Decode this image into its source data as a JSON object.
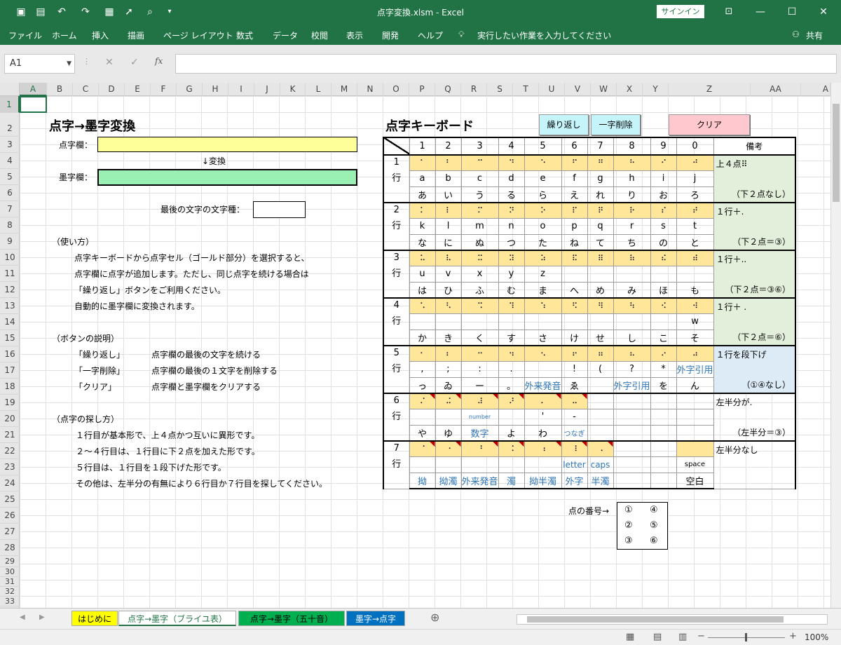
{
  "window": {
    "title": "点字変換.xlsm  -  Excel",
    "signin": "サインイン",
    "share": "共有"
  },
  "menu": {
    "items": [
      "ファイル",
      "ホーム",
      "挿入",
      "描画",
      "ページ レイアウト",
      "数式",
      "データ",
      "校閲",
      "表示",
      "開発",
      "ヘルプ"
    ],
    "tell_me": "実行したい作業を入力してください"
  },
  "formula_bar": {
    "name_box": "A1",
    "fx": "fx",
    "value": ""
  },
  "columns": [
    "A",
    "B",
    "C",
    "D",
    "E",
    "F",
    "G",
    "H",
    "I",
    "J",
    "K",
    "L",
    "M",
    "N",
    "O",
    "P",
    "Q",
    "R",
    "S",
    "T",
    "U",
    "V",
    "W",
    "X",
    "Y",
    "Z",
    "AA",
    "A"
  ],
  "rows": [
    "1",
    "2",
    "3",
    "4",
    "5",
    "6",
    "7",
    "8",
    "9",
    "10",
    "11",
    "12",
    "13",
    "14",
    "15",
    "16",
    "17",
    "18",
    "19",
    "20",
    "21",
    "22",
    "23",
    "24",
    "25",
    "26",
    "27",
    "28",
    "29",
    "30",
    "31",
    "32",
    "33"
  ],
  "left": {
    "title": "点字→墨字変換",
    "braille_label": "点字欄：",
    "convert_label": "↓変換",
    "text_label": "墨字欄：",
    "last_type_label": "最後の文字の文字種：",
    "usage_head": "（使い方）",
    "usage": [
      "点字キーボードから点字セル（ゴールド部分）を選択すると、",
      "点字欄に点字が追加します。ただし、同じ点字を続ける場合は",
      "「繰り返し」ボタンをご利用ください。",
      "自動的に墨字欄に変換されます。"
    ],
    "buttons_head": "（ボタンの説明）",
    "buttons": [
      [
        "「繰り返し」",
        "点字欄の最後の文字を続ける"
      ],
      [
        "「一字削除」",
        "点字欄の最後の１文字を削除する"
      ],
      [
        "「クリア」",
        "点字欄と墨字欄をクリアする"
      ]
    ],
    "search_head": "（点字の探し方）",
    "search": [
      "１行目が基本形で、上４点かつ互いに異形です。",
      "２～４行目は、１行目に下２点を加えた形です。",
      "５行目は、１行目を１段下げた形です。",
      "その他は、左半分の有無により６行目か７行目を探してください。"
    ]
  },
  "keyboard": {
    "title": "点字キーボード",
    "repeat_btn": "繰り返し",
    "delete_btn": "一字削除",
    "clear_btn": "クリア",
    "col_nums": [
      "1",
      "2",
      "3",
      "4",
      "5",
      "6",
      "7",
      "8",
      "9",
      "0"
    ],
    "remarks_header": "備考",
    "rows": [
      {
        "num": "1",
        "label": "行",
        "dots": [
          "⠁",
          "⠃",
          "⠉",
          "⠙",
          "⠑",
          "⠋",
          "⠛",
          "⠓",
          "⠊",
          "⠚"
        ],
        "r1": [
          "a",
          "b",
          "c",
          "d",
          "e",
          "f",
          "g",
          "h",
          "i",
          "j"
        ],
        "r2": [
          "あ",
          "い",
          "う",
          "る",
          "ら",
          "え",
          "れ",
          "り",
          "お",
          "ろ"
        ],
        "note": "上４点⠿",
        "note_sub": "（下２点なし）"
      },
      {
        "num": "2",
        "label": "行",
        "dots": [
          "⠅",
          "⠇",
          "⠍",
          "⠝",
          "⠕",
          "⠏",
          "⠟",
          "⠗",
          "⠎",
          "⠞"
        ],
        "r1": [
          "k",
          "l",
          "m",
          "n",
          "o",
          "p",
          "q",
          "r",
          "s",
          "t"
        ],
        "r2": [
          "な",
          "に",
          "ぬ",
          "つ",
          "た",
          "ね",
          "て",
          "ち",
          "の",
          "と"
        ],
        "note": "１行＋.",
        "note_sub": "（下２点＝③）"
      },
      {
        "num": "3",
        "label": "行",
        "dots": [
          "⠥",
          "⠧",
          "⠭",
          "⠽",
          "⠵",
          "⠯",
          "⠿",
          "⠷",
          "⠮",
          "⠾"
        ],
        "r1": [
          "u",
          "v",
          "x",
          "y",
          "z",
          "",
          "",
          "",
          "",
          ""
        ],
        "r2": [
          "は",
          "ひ",
          "ふ",
          "む",
          "ま",
          "へ",
          "め",
          "み",
          "ほ",
          "も"
        ],
        "note": "１行＋..",
        "note_sub": "（下２点＝③⑥）"
      },
      {
        "num": "4",
        "label": "行",
        "dots": [
          "⠡",
          "⠣",
          "⠩",
          "⠹",
          "⠱",
          "⠫",
          "⠻",
          "⠳",
          "⠪",
          "⠺"
        ],
        "r1": [
          "",
          "",
          "",
          "",
          "",
          "",
          "",
          "",
          "",
          "w"
        ],
        "r2": [
          "か",
          "き",
          "く",
          "す",
          "さ",
          "け",
          "せ",
          "し",
          "こ",
          "そ"
        ],
        "note": "１行＋ .",
        "note_sub": "（下２点＝⑥）"
      },
      {
        "num": "5",
        "label": "行",
        "dots": [
          "⠂",
          "⠆",
          "⠒",
          "⠲",
          "⠢",
          "⠖",
          "⠶",
          "⠦",
          "⠔",
          "⠴"
        ],
        "r1": [
          ",",
          ";",
          ":",
          ".",
          "",
          "!",
          "(",
          "?",
          "*",
          "外字引用"
        ],
        "r2": [
          "っ",
          "ゐ",
          "ー",
          "。",
          "外来発音",
          "ゑ",
          "",
          "外字引用",
          "を",
          "ん"
        ],
        "note": "１行を段下げ",
        "note_sub": "（①④なし）"
      },
      {
        "num": "6",
        "label": "行",
        "dots": [
          "⠌",
          "⠬",
          "⠼",
          "⠜",
          "⠄",
          "⠤",
          "",
          "",
          "",
          ""
        ],
        "r1": [
          "",
          "",
          "number",
          "",
          "'",
          "-",
          "",
          "",
          "",
          ""
        ],
        "r2": [
          "や",
          "ゆ",
          "数字",
          "よ",
          "わ",
          "つなぎ",
          "",
          "",
          "",
          ""
        ],
        "note": "左半分が.",
        "note_sub": "（左半分＝③）"
      },
      {
        "num": "7",
        "label": "行",
        "dots": [
          "⠈",
          "⠐",
          "⠘",
          "⠨",
          "⠰",
          "⠸",
          "⠠",
          "",
          "",
          ""
        ],
        "r1": [
          "",
          "",
          "",
          "",
          "",
          "letter",
          "caps",
          "",
          "",
          "space"
        ],
        "r2": [
          "拗",
          "拗濁",
          "外来発音",
          "濁",
          "拗半濁",
          "外字",
          "半濁",
          "",
          "",
          "空白"
        ],
        "note": "左半分なし",
        "note_sub": ""
      }
    ],
    "dots_label": "点の番号→",
    "dots_nums": [
      [
        "①",
        "④"
      ],
      [
        "②",
        "⑤"
      ],
      [
        "③",
        "⑥"
      ]
    ]
  },
  "sheets": {
    "tabs": [
      "はじめに",
      "点字→墨字（ブライユ表）",
      "点字→墨字（五十音）",
      "墨字→点字"
    ],
    "add": "⊕"
  },
  "status": {
    "zoom": "100%"
  },
  "colors": {
    "excel_green": "#217346",
    "gold": "#ffe699",
    "yellow": "#ffff99",
    "mint": "#99f0b2",
    "repeat_btn": "#c5f5fb",
    "clear_btn": "#ffc7ce",
    "note_green": "#e2efda",
    "note_blue": "#ddebf7"
  }
}
